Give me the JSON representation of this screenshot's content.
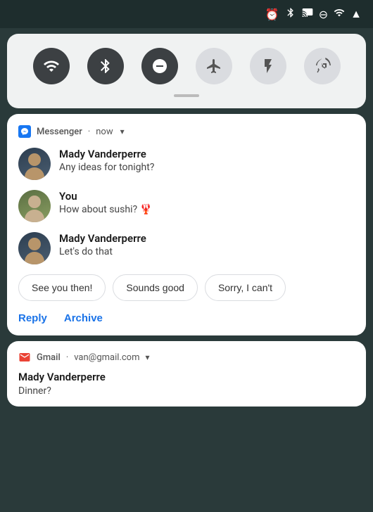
{
  "statusBar": {
    "icons": [
      "alarm",
      "bluetooth",
      "cast",
      "dnd",
      "wifi",
      "signal"
    ]
  },
  "quickSettings": {
    "icons": [
      {
        "name": "wifi",
        "label": "Wi-Fi",
        "active": true
      },
      {
        "name": "bluetooth",
        "label": "Bluetooth",
        "active": true
      },
      {
        "name": "dnd",
        "label": "Do Not Disturb",
        "active": true
      },
      {
        "name": "airplane",
        "label": "Airplane Mode",
        "active": false
      },
      {
        "name": "flashlight",
        "label": "Flashlight",
        "active": false
      },
      {
        "name": "rotate",
        "label": "Auto Rotate",
        "active": false
      }
    ]
  },
  "messengerNotification": {
    "appName": "Messenger",
    "time": "now",
    "messages": [
      {
        "sender": "Mady Vanderperre",
        "text": "Any ideas for tonight?",
        "isYou": false
      },
      {
        "sender": "You",
        "text": "How about sushi? 🦞",
        "isYou": true
      },
      {
        "sender": "Mady Vanderperre",
        "text": "Let's do that",
        "isYou": false
      }
    ],
    "quickReplies": [
      {
        "label": "See you then!"
      },
      {
        "label": "Sounds good"
      },
      {
        "label": "Sorry, I can't"
      }
    ],
    "actions": [
      {
        "label": "Reply"
      },
      {
        "label": "Archive"
      }
    ]
  },
  "gmailNotification": {
    "appName": "Gmail",
    "account": "van@gmail.com",
    "sender": "Mady Vanderperre",
    "subject": "Dinner?"
  }
}
